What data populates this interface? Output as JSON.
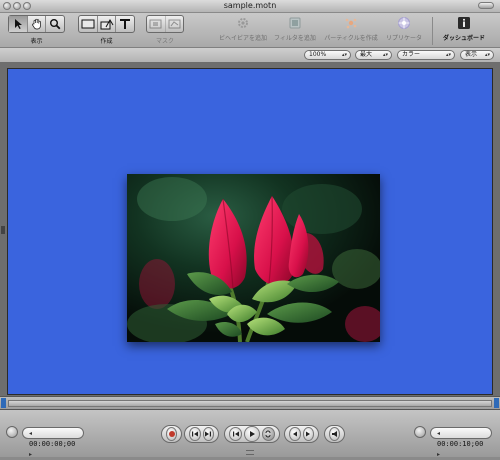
{
  "window": {
    "title": "sample.motn"
  },
  "toolbar": {
    "groups": [
      {
        "label": "表示"
      },
      {
        "label": "作成"
      },
      {
        "label": "マスク"
      }
    ],
    "actions": [
      {
        "label": "ビヘイビアを追加",
        "icon": "behavior-gear-icon"
      },
      {
        "label": "フィルタを追加",
        "icon": "filter-icon"
      },
      {
        "label": "パーティクルを作成",
        "icon": "particles-icon"
      },
      {
        "label": "リプリケータ",
        "icon": "replicator-icon"
      },
      {
        "label": "ダッシュボード",
        "icon": "info-icon"
      }
    ]
  },
  "options": {
    "zoom": "100%",
    "resolution": "最大",
    "channels": "カラー",
    "view": "表示"
  },
  "canvas": {
    "background": "#3a64de"
  },
  "transport": {
    "current_time": "00:00:00;00",
    "duration": "00:00:10;00"
  },
  "colors": {
    "accent": "#2e6ab8",
    "record": "#c0392b"
  }
}
